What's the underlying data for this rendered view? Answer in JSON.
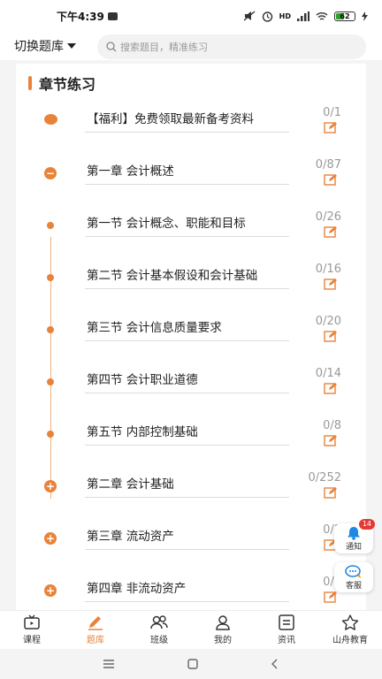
{
  "status_bar": {
    "time": "下午4:39",
    "network_label": "HD",
    "battery_level": "62"
  },
  "header": {
    "bank_switch_label": "切换题库",
    "search_placeholder": "搜索题目，精准练习"
  },
  "section": {
    "title": "章节练习"
  },
  "chapters": [
    {
      "label": "【福利】免费领取最新备考资料",
      "count": "0/1",
      "marker": "filled"
    },
    {
      "label": "第一章 会计概述",
      "count": "0/87",
      "marker": "minus"
    },
    {
      "label": "第一节 会计概念、职能和目标",
      "count": "0/26",
      "marker": "small"
    },
    {
      "label": "第二节 会计基本假设和会计基础",
      "count": "0/16",
      "marker": "small"
    },
    {
      "label": "第三节 会计信息质量要求",
      "count": "0/20",
      "marker": "small"
    },
    {
      "label": "第四节 会计职业道德",
      "count": "0/14",
      "marker": "small"
    },
    {
      "label": "第五节 内部控制基础",
      "count": "0/8",
      "marker": "small"
    },
    {
      "label": "第二章 会计基础",
      "count": "0/252",
      "marker": "plus"
    },
    {
      "label": "第三章 流动资产",
      "count": "0/2",
      "marker": "plus"
    },
    {
      "label": "第四章 非流动资产",
      "count": "0/1",
      "marker": "plus"
    }
  ],
  "floating": {
    "notify_label": "通知",
    "notify_badge": "14",
    "service_label": "客服"
  },
  "bottom_nav": [
    {
      "label": "课程",
      "icon": "tv-icon"
    },
    {
      "label": "题库",
      "icon": "pencil-icon"
    },
    {
      "label": "班级",
      "icon": "group-icon"
    },
    {
      "label": "我的",
      "icon": "person-icon"
    },
    {
      "label": "资讯",
      "icon": "news-icon"
    },
    {
      "label": "山舟教育",
      "icon": "star-icon"
    }
  ],
  "colors": {
    "accent": "#e8833a",
    "badge": "#e53935",
    "notify_icon": "#1e88e5"
  }
}
